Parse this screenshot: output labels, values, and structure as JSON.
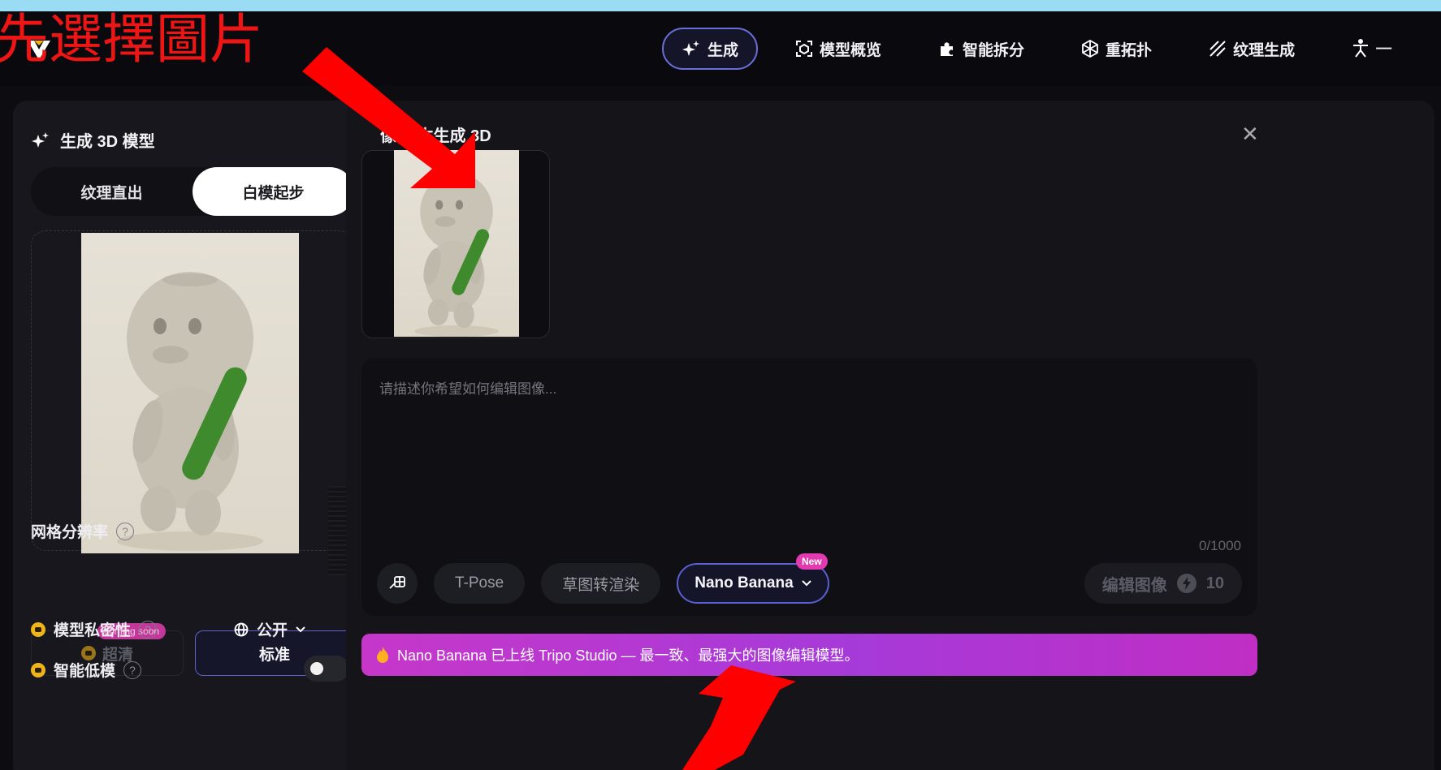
{
  "annotation": {
    "text": "先選擇圖片"
  },
  "nav": {
    "items": [
      {
        "label": "生成",
        "icon": "sparkle-icon",
        "active": true
      },
      {
        "label": "模型概览",
        "icon": "cube-frame-icon"
      },
      {
        "label": "智能拆分",
        "icon": "puzzle-icon"
      },
      {
        "label": "重拓扑",
        "icon": "mesh-icon"
      },
      {
        "label": "纹理生成",
        "icon": "hatch-icon"
      },
      {
        "label": "—",
        "icon": "rig-figure-icon"
      }
    ]
  },
  "left": {
    "title": "生成 3D 模型",
    "segments": [
      "纹理直出",
      "白模起步"
    ],
    "active_segment": 1,
    "resolution_label": "网格分辨率",
    "resolution_options": [
      "超清",
      "标准"
    ],
    "coming_soon": "coming soon",
    "privacy_label": "模型私密性",
    "privacy_value": "公开",
    "lowpoly_label": "智能低模",
    "lowpoly_on": false
  },
  "main": {
    "title": "像/文本生成 3D",
    "placeholder": "请描述你希望如何编辑图像...",
    "counter": "0/1000",
    "tools": [
      "T-Pose",
      "草图转渲染"
    ],
    "model": "Nano Banana",
    "new_badge": "New",
    "edit_label": "编辑图像",
    "edit_cost": "10",
    "banner": "Nano Banana 已上线 Tripo Studio — 最一致、最强大的图像编辑模型。"
  },
  "colors": {
    "annotation": "#f01515",
    "accent": "#5b5fcf",
    "banner_start": "#c637c9",
    "banner_end": "#a63ad9",
    "gold": "#f0b318"
  }
}
